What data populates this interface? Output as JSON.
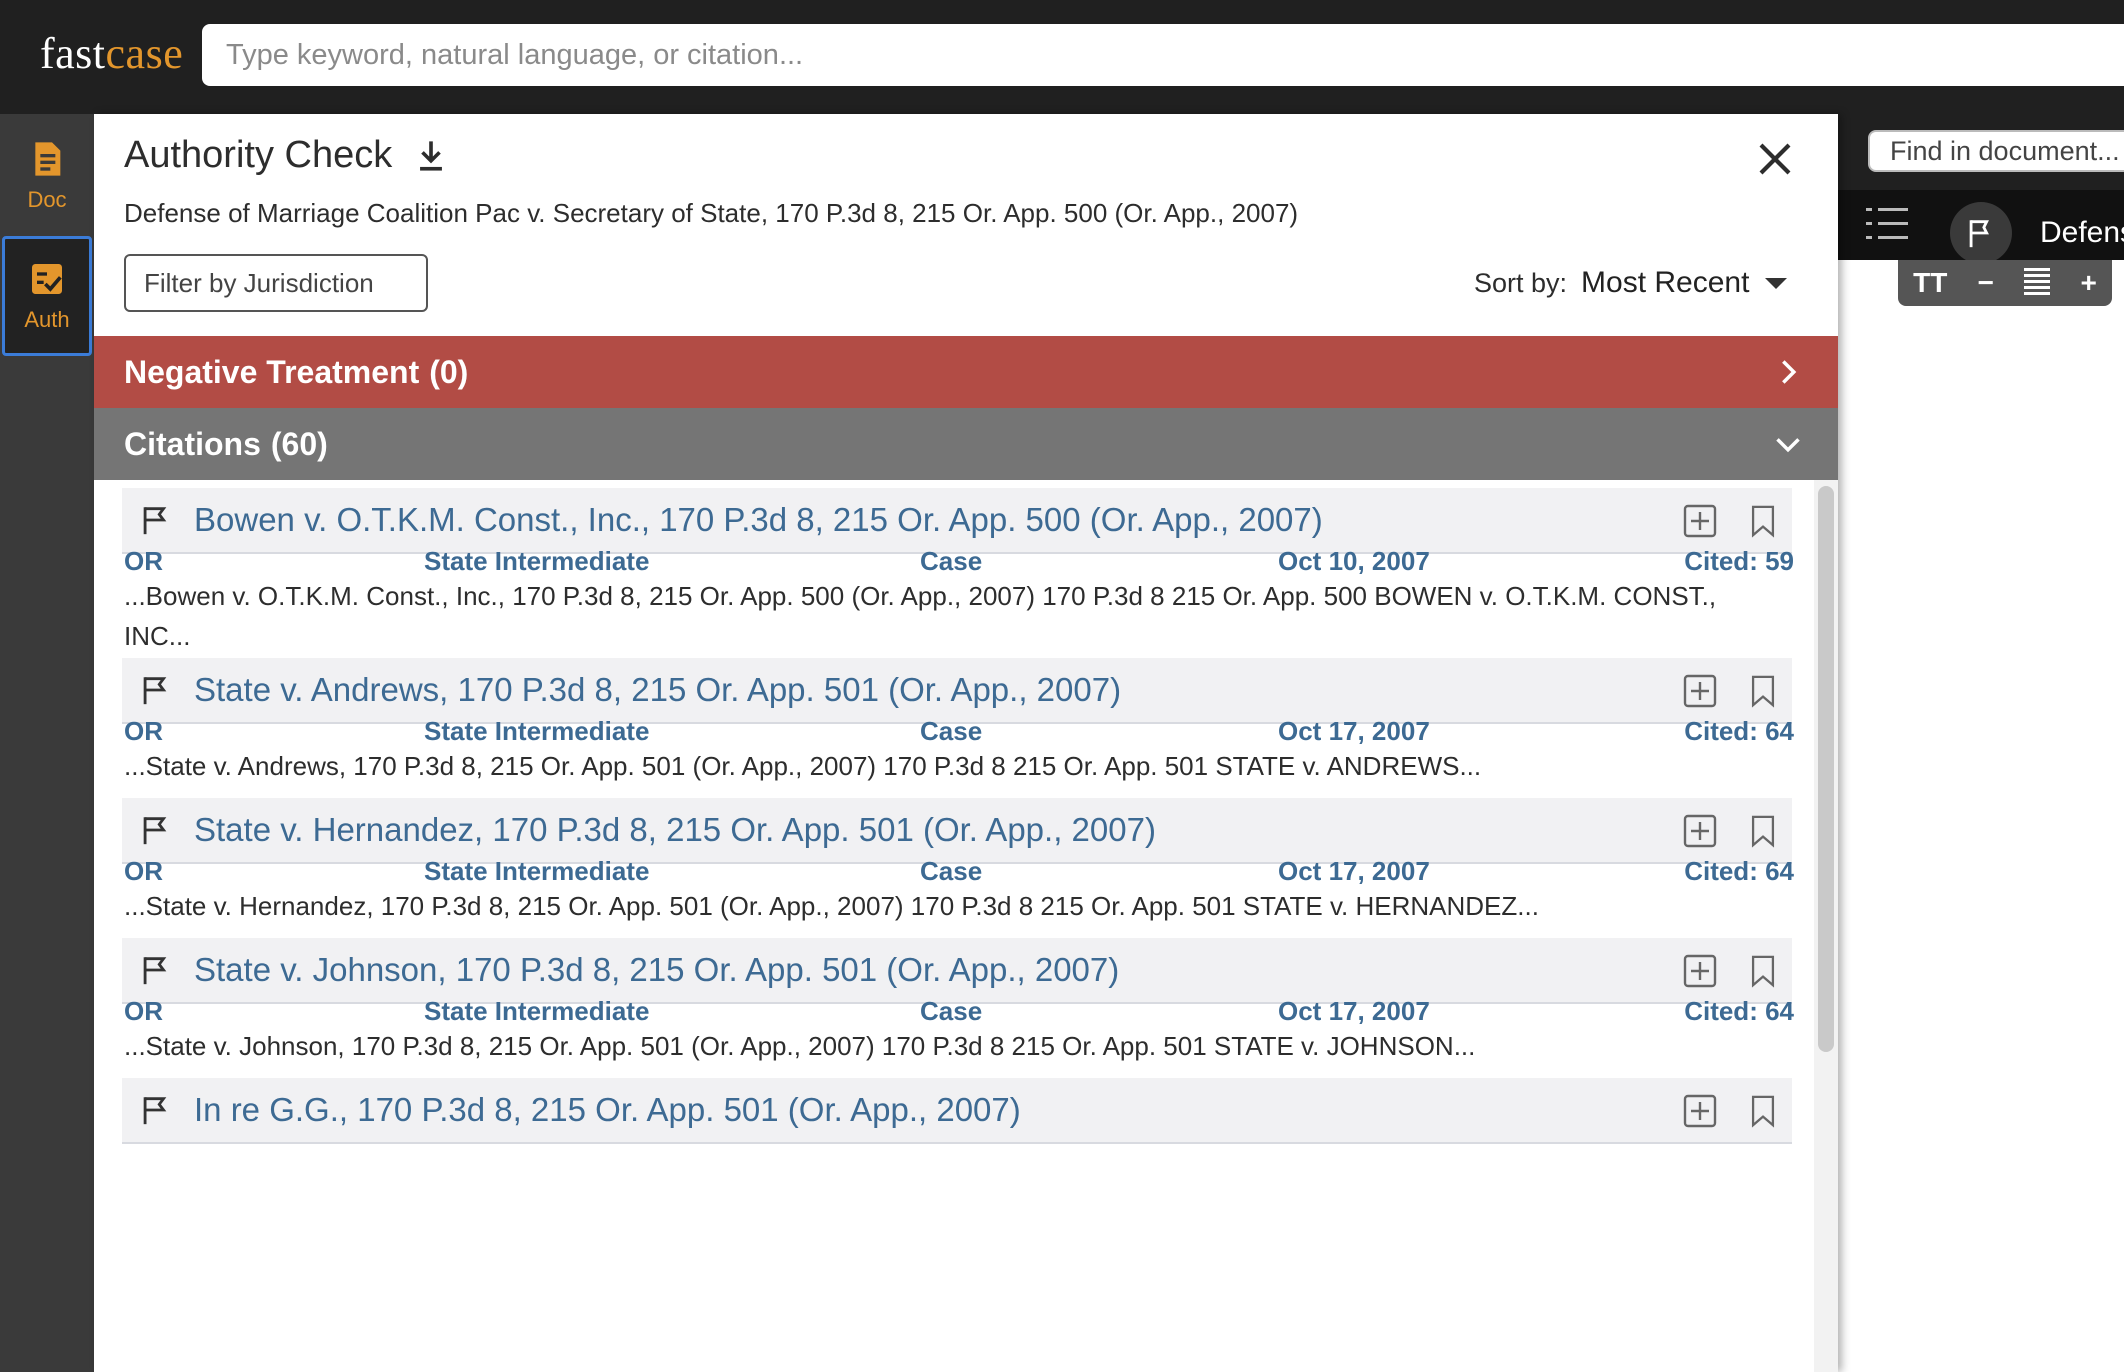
{
  "app": {
    "logo_fast": "fast",
    "logo_case": "case",
    "search_placeholder": "Type keyword, natural language, or citation..."
  },
  "rail": {
    "doc_label": "Doc",
    "auth_label": "Auth"
  },
  "document": {
    "find_placeholder": "Find in document...",
    "title": "Defens",
    "zoom": {
      "text_icon": "TT",
      "minus": "−",
      "plus": "+"
    }
  },
  "panel": {
    "title": "Authority Check",
    "case_ref": "Defense of Marriage Coalition Pac v. Secretary of State, 170 P.3d 8, 215 Or. App. 500 (Or. App., 2007)",
    "filter_label": "Filter by Jurisdiction",
    "sort_label": "Sort by:",
    "sort_value": "Most Recent",
    "negative": {
      "label": "Negative Treatment",
      "count": "(0)"
    },
    "citations": {
      "label": "Citations",
      "count": "(60)"
    }
  },
  "citations": [
    {
      "title": "Bowen v. O.T.K.M. Const., Inc., 170 P.3d 8, 215 Or. App. 500 (Or. App., 2007)",
      "jurisdiction": "OR",
      "court": "State Intermediate",
      "type": "Case",
      "date": "Oct 10, 2007",
      "cited": "Cited: 59",
      "snippet": "...Bowen v. O.T.K.M. Const., Inc., 170 P.3d 8, 215 Or. App. 500 (Or. App., 2007) 170 P.3d 8 215 Or. App. 500 BOWEN v. O.T.K.M. CONST., INC..."
    },
    {
      "title": "State v. Andrews, 170 P.3d 8, 215 Or. App. 501 (Or. App., 2007)",
      "jurisdiction": "OR",
      "court": "State Intermediate",
      "type": "Case",
      "date": "Oct 17, 2007",
      "cited": "Cited: 64",
      "snippet": "...State v. Andrews, 170 P.3d 8, 215 Or. App. 501 (Or. App., 2007) 170 P.3d 8 215 Or. App. 501 STATE v. ANDREWS..."
    },
    {
      "title": "State v. Hernandez, 170 P.3d 8, 215 Or. App. 501 (Or. App., 2007)",
      "jurisdiction": "OR",
      "court": "State Intermediate",
      "type": "Case",
      "date": "Oct 17, 2007",
      "cited": "Cited: 64",
      "snippet": "...State v. Hernandez, 170 P.3d 8, 215 Or. App. 501 (Or. App., 2007) 170 P.3d 8 215 Or. App. 501 STATE v. HERNANDEZ..."
    },
    {
      "title": "State v. Johnson, 170 P.3d 8, 215 Or. App. 501 (Or. App., 2007)",
      "jurisdiction": "OR",
      "court": "State Intermediate",
      "type": "Case",
      "date": "Oct 17, 2007",
      "cited": "Cited: 64",
      "snippet": "...State v. Johnson, 170 P.3d 8, 215 Or. App. 501 (Or. App., 2007) 170 P.3d 8 215 Or. App. 501 STATE v. JOHNSON..."
    },
    {
      "title": "In re G.G., 170 P.3d 8, 215 Or. App. 501 (Or. App., 2007)"
    }
  ],
  "colors": {
    "accent": "#e3962c",
    "link": "#3d6a93",
    "negative_band": "#b24c45",
    "citations_band": "#757575"
  },
  "icons": [
    "doc-icon",
    "auth-icon",
    "download-icon",
    "close-icon",
    "chevron-right-icon",
    "chevron-down-icon",
    "flag-icon",
    "add-icon",
    "bookmark-icon",
    "list-icon"
  ]
}
